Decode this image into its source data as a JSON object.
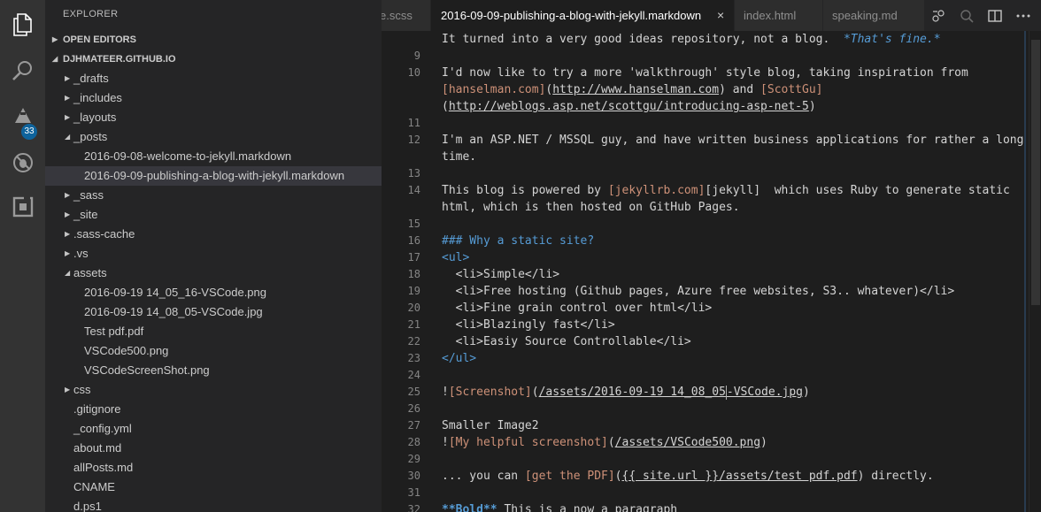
{
  "activity_bar": {
    "icons": [
      "files-icon",
      "search-icon",
      "git-icon",
      "debug-icon",
      "extensions-icon"
    ],
    "git_badge": "33"
  },
  "sidebar": {
    "title": "EXPLORER",
    "open_editors": "OPEN EDITORS",
    "folder": "DJHMATEER.GITHUB.IO",
    "items": [
      {
        "label": "_drafts",
        "type": "folder",
        "expanded": false,
        "depth": 1
      },
      {
        "label": "_includes",
        "type": "folder",
        "expanded": false,
        "depth": 1
      },
      {
        "label": "_layouts",
        "type": "folder",
        "expanded": false,
        "depth": 1
      },
      {
        "label": "_posts",
        "type": "folder",
        "expanded": true,
        "depth": 1
      },
      {
        "label": "2016-09-08-welcome-to-jekyll.markdown",
        "type": "file",
        "depth": 2
      },
      {
        "label": "2016-09-09-publishing-a-blog-with-jekyll.markdown",
        "type": "file",
        "depth": 2,
        "selected": true
      },
      {
        "label": "_sass",
        "type": "folder",
        "expanded": false,
        "depth": 1
      },
      {
        "label": "_site",
        "type": "folder",
        "expanded": false,
        "depth": 1
      },
      {
        "label": ".sass-cache",
        "type": "folder",
        "expanded": false,
        "depth": 1
      },
      {
        "label": ".vs",
        "type": "folder",
        "expanded": false,
        "depth": 1
      },
      {
        "label": "assets",
        "type": "folder",
        "expanded": true,
        "depth": 1
      },
      {
        "label": "2016-09-19 14_05_16-VSCode.png",
        "type": "file",
        "depth": 2
      },
      {
        "label": "2016-09-19 14_08_05-VSCode.jpg",
        "type": "file",
        "depth": 2
      },
      {
        "label": "Test pdf.pdf",
        "type": "file",
        "depth": 2
      },
      {
        "label": "VSCode500.png",
        "type": "file",
        "depth": 2
      },
      {
        "label": "VSCodeScreenShot.png",
        "type": "file",
        "depth": 2
      },
      {
        "label": "css",
        "type": "folder",
        "expanded": false,
        "depth": 1
      },
      {
        "label": ".gitignore",
        "type": "file",
        "depth": 1
      },
      {
        "label": "_config.yml",
        "type": "file",
        "depth": 1
      },
      {
        "label": "about.md",
        "type": "file",
        "depth": 1
      },
      {
        "label": "allPosts.md",
        "type": "file",
        "depth": 1
      },
      {
        "label": "CNAME",
        "type": "file",
        "depth": 1
      },
      {
        "label": "d.ps1",
        "type": "file",
        "depth": 1
      }
    ]
  },
  "tabs": [
    {
      "label": "e.scss",
      "active": false
    },
    {
      "label": "2016-09-09-publishing-a-blog-with-jekyll.markdown",
      "active": true,
      "close": "×"
    },
    {
      "label": "index.html",
      "active": false
    },
    {
      "label": "speaking.md",
      "active": false
    }
  ],
  "editor": {
    "lines": [
      {
        "n": "",
        "segs": [
          [
            "t",
            "It turned into a very good ideas repository, not a blog.  "
          ],
          [
            "i",
            "*That's fine.*"
          ]
        ]
      },
      {
        "n": "9",
        "segs": []
      },
      {
        "n": "10",
        "segs": [
          [
            "t",
            "I'd now like to try a more 'walkthrough' style blog, taking inspiration from"
          ]
        ]
      },
      {
        "n": "",
        "segs": [
          [
            "o",
            "[hanselman.com]"
          ],
          [
            "t",
            "("
          ],
          [
            "u",
            "http://www.hanselman.com"
          ],
          [
            "t",
            ") and "
          ],
          [
            "o",
            "[ScottGu]"
          ]
        ]
      },
      {
        "n": "",
        "segs": [
          [
            "t",
            "("
          ],
          [
            "u",
            "http://weblogs.asp.net/scottgu/introducing-asp-net-5"
          ],
          [
            "t",
            ")"
          ]
        ]
      },
      {
        "n": "11",
        "segs": []
      },
      {
        "n": "12",
        "segs": [
          [
            "t",
            "I'm an ASP.NET / MSSQL guy, and have written business applications for rather a long"
          ]
        ]
      },
      {
        "n": "",
        "segs": [
          [
            "t",
            "time."
          ]
        ]
      },
      {
        "n": "13",
        "segs": []
      },
      {
        "n": "14",
        "segs": [
          [
            "t",
            "This blog is powered by "
          ],
          [
            "o",
            "[jekyllrb.com]"
          ],
          [
            "t",
            "[jekyll]  which uses Ruby to generate static"
          ]
        ]
      },
      {
        "n": "",
        "segs": [
          [
            "t",
            "html, which is then hosted on GitHub Pages."
          ]
        ]
      },
      {
        "n": "15",
        "segs": []
      },
      {
        "n": "16",
        "segs": [
          [
            "k",
            "### Why a static site?"
          ]
        ]
      },
      {
        "n": "17",
        "segs": [
          [
            "k",
            "<ul>"
          ]
        ]
      },
      {
        "n": "18",
        "segs": [
          [
            "t",
            "  <li>Simple</li>"
          ]
        ]
      },
      {
        "n": "19",
        "segs": [
          [
            "t",
            "  <li>Free hosting (Github pages, Azure free websites, S3.. whatever)</li>"
          ]
        ]
      },
      {
        "n": "20",
        "segs": [
          [
            "t",
            "  <li>Fine grain control over html</li>"
          ]
        ]
      },
      {
        "n": "21",
        "segs": [
          [
            "t",
            "  <li>Blazingly fast</li>"
          ]
        ]
      },
      {
        "n": "22",
        "segs": [
          [
            "t",
            "  <li>Easiy Source Controllable</li>"
          ]
        ]
      },
      {
        "n": "23",
        "segs": [
          [
            "k",
            "</ul>"
          ]
        ]
      },
      {
        "n": "24",
        "segs": []
      },
      {
        "n": "25",
        "segs": [
          [
            "t",
            "!"
          ],
          [
            "o",
            "[Screenshot]"
          ],
          [
            "t",
            "("
          ],
          [
            "u",
            "/assets/2016-09-19 14_08_05"
          ],
          [
            "c",
            ""
          ],
          [
            "u",
            "-VSCode.jpg"
          ],
          [
            "t",
            ")"
          ]
        ]
      },
      {
        "n": "26",
        "segs": []
      },
      {
        "n": "27",
        "segs": [
          [
            "t",
            "Smaller Image2"
          ]
        ]
      },
      {
        "n": "28",
        "segs": [
          [
            "t",
            "!"
          ],
          [
            "o",
            "[My helpful screenshot]"
          ],
          [
            "t",
            "("
          ],
          [
            "u",
            "/assets/VSCode500.png"
          ],
          [
            "t",
            ")"
          ]
        ]
      },
      {
        "n": "29",
        "segs": []
      },
      {
        "n": "30",
        "segs": [
          [
            "t",
            "... you can "
          ],
          [
            "o",
            "[get the PDF]"
          ],
          [
            "t",
            "("
          ],
          [
            "u",
            "{{ site.url }}/assets/test pdf.pdf"
          ],
          [
            "t",
            ") directly."
          ]
        ]
      },
      {
        "n": "31",
        "segs": []
      },
      {
        "n": "32",
        "segs": [
          [
            "b",
            "**Bold**"
          ],
          [
            "t",
            " This is a now a paragraph"
          ]
        ]
      }
    ]
  }
}
